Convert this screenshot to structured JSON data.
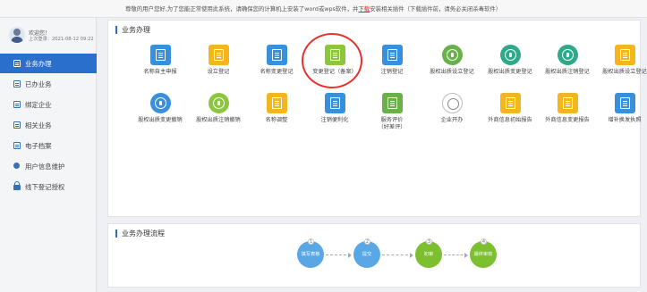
{
  "notice": {
    "before": "尊敬的用户您好,为了您能正常使用此系统，请确保您的计算机上安装了word或wps软件，并",
    "link": "下载",
    "after": "安装相关插件（下载插件前，请务必关闭杀毒软件）"
  },
  "user": {
    "welcome": "欢迎您！",
    "last_login": "上次登录：2021-08-12 09:22"
  },
  "sidebar": {
    "items": [
      {
        "label": "业务办理",
        "icon": "doc-icon",
        "active": true
      },
      {
        "label": "已办业务",
        "icon": "doc-icon"
      },
      {
        "label": "绑定企业",
        "icon": "doc-icon"
      },
      {
        "label": "相关业务",
        "icon": "doc-icon"
      },
      {
        "label": "电子档案",
        "icon": "doc-icon"
      },
      {
        "label": "用户信息维护",
        "icon": "user-icon"
      },
      {
        "label": "线下登记授权",
        "icon": "lock-icon"
      }
    ]
  },
  "business": {
    "title": "业务办理",
    "tiles": [
      {
        "label": "名称自主申报",
        "color": "#3a8fd9",
        "icon": "building-icon"
      },
      {
        "label": "设立登记",
        "color": "#f0b81c",
        "icon": "form-icon"
      },
      {
        "label": "名称变更登记",
        "color": "#3a8fd9",
        "icon": "form-edit-icon"
      },
      {
        "label": "变更登记（备案）",
        "color": "#8cc63f",
        "icon": "clipboard-icon"
      },
      {
        "label": "注销登记",
        "color": "#3a8fd9",
        "icon": "doc-edit-icon"
      },
      {
        "label": "股权出质设立登记",
        "color": "#6ab04c",
        "icon": "pie-icon"
      },
      {
        "label": "股权出质变更登记",
        "color": "#2eaa8a",
        "icon": "pie-icon"
      },
      {
        "label": "股权出质注销登记",
        "color": "#2eaa8a",
        "icon": "pie-icon"
      },
      {
        "label": "股权出质设立登记",
        "color": "#f0b81c",
        "icon": "list-icon"
      },
      {
        "label": "股权出质变更撤销",
        "color": "#3a8fd9",
        "icon": "shield-icon"
      },
      {
        "label": "股权出质注销撤销",
        "color": "#8cc63f",
        "icon": "cancel-icon"
      },
      {
        "label": "名称调整",
        "color": "#f0b81c",
        "icon": "form-icon"
      },
      {
        "label": "注销便利化",
        "color": "#3a8fd9",
        "icon": "doc-icon"
      },
      {
        "label": "服务评价",
        "sub": "（好差评）",
        "color": "#6ab04c",
        "icon": "star-icon"
      },
      {
        "label": "企业开办",
        "color": "#fff",
        "icon": "divide-icon"
      },
      {
        "label": "外商信息初始报告",
        "color": "#f0b81c",
        "icon": "report-icon"
      },
      {
        "label": "外商信息变更报告",
        "color": "#f0b81c",
        "icon": "report-icon"
      },
      {
        "label": "增补换发执照",
        "color": "#3a8fd9",
        "icon": "license-icon"
      }
    ]
  },
  "flow": {
    "title": "业务办理流程",
    "steps": [
      {
        "num": "1",
        "label": "填写表格",
        "color": "#5aa7e6"
      },
      {
        "num": "2",
        "label": "提交",
        "color": "#5aa7e6"
      },
      {
        "num": "3",
        "label": "初审",
        "color": "#7cbf2f"
      },
      {
        "num": "4",
        "label": "最终审核",
        "color": "#7cbf2f"
      }
    ]
  }
}
